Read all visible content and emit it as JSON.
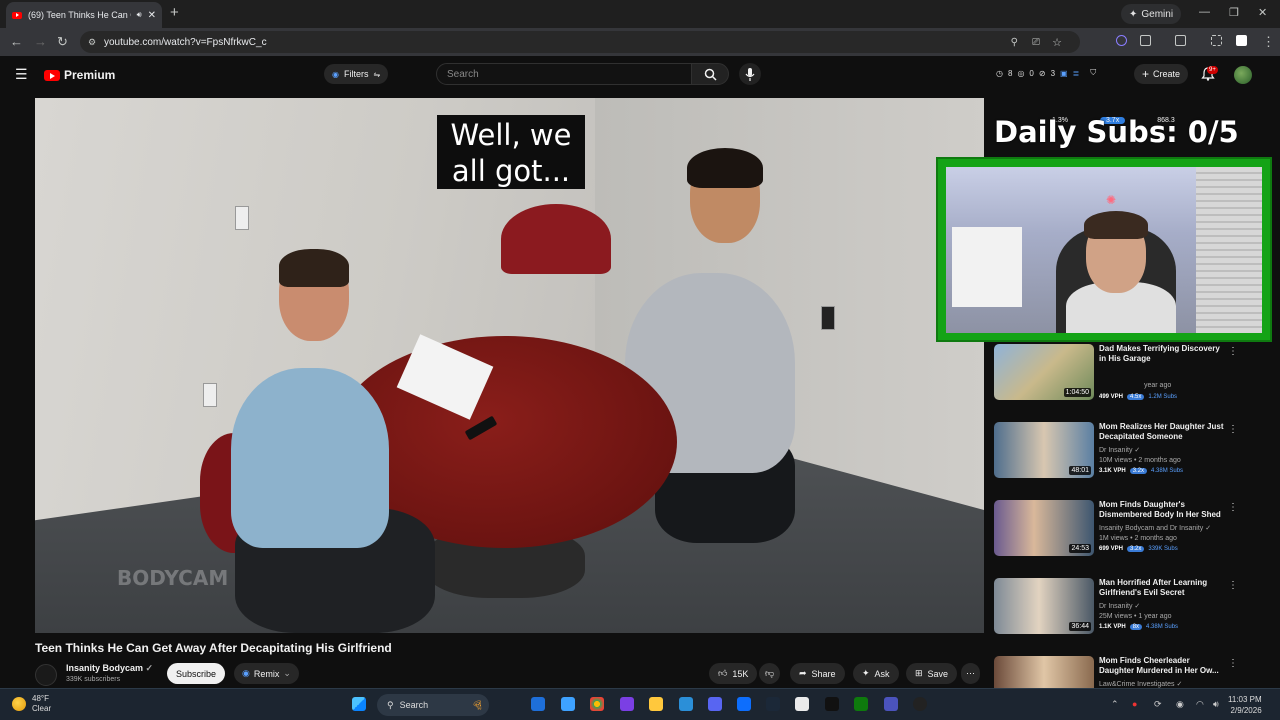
{
  "browser": {
    "tab_title": "(69) Teen Thinks He Can Ge",
    "new_tab": "+",
    "gemini_label": "Gemini",
    "url": "youtube.com/watch?v=FpsNfrkwC_c"
  },
  "youtube": {
    "brand": "Premium",
    "filters_label": "Filters",
    "search_placeholder": "Search",
    "header_stats": [
      "8",
      "0",
      "3"
    ],
    "create_label": "Create",
    "notif_badge": "9+"
  },
  "video": {
    "caption_line1": "Well, we",
    "caption_line2": "all got...",
    "watermark": "BODYCAM",
    "title": "Teen Thinks He Can Get Away After Decapitating His Girlfriend",
    "channel": "Insanity Bodycam",
    "subscribers": "339K subscribers",
    "subscribe_label": "Subscribe",
    "remix_label": "Remix",
    "likes": "15K",
    "share_label": "Share",
    "ask_label": "Ask",
    "save_label": "Save"
  },
  "overlay": {
    "stats": [
      "1.3%",
      "3.7x",
      "868.3"
    ],
    "daily_subs": "Daily Subs: 0/5"
  },
  "recommendations": [
    {
      "title": "Dad Makes Terrifying Discovery in His Garage",
      "channel": "",
      "meta": "year ago",
      "duration": "1:04:50",
      "vph": "499 VPH",
      "ratio": "4.5x",
      "subs": "1.2M Subs"
    },
    {
      "title": "Mom Realizes Her Daughter Just Decapitated Someone",
      "channel": "Dr Insanity",
      "meta": "10M views • 2 months ago",
      "duration": "48:01",
      "vph": "3.1K VPH",
      "ratio": "3.2x",
      "subs": "4.38M Subs"
    },
    {
      "title": "Mom Finds Daughter's Dismembered Body In Her Shed",
      "channel": "Insanity Bodycam and Dr Insanity",
      "meta": "1M views • 2 months ago",
      "duration": "24:53",
      "vph": "699 VPH",
      "ratio": "3.2x",
      "subs": "339K Subs"
    },
    {
      "title": "Man Horrified After Learning Girlfriend's Evil Secret",
      "channel": "Dr Insanity",
      "meta": "25M views • 1 year ago",
      "duration": "36:44",
      "vph": "1.1K VPH",
      "ratio": "8x",
      "subs": "4.38M Subs"
    },
    {
      "title": "Mom Finds Cheerleader Daughter Murdered in Her Ow...",
      "channel": "Law&Crime Investigates",
      "meta": "",
      "duration": "",
      "vph": "",
      "ratio": "",
      "subs": ""
    }
  ],
  "taskbar": {
    "temp": "48°F",
    "condition": "Clear",
    "search_label": "Search",
    "time": "11:03 PM",
    "date": "2/9/2026"
  }
}
